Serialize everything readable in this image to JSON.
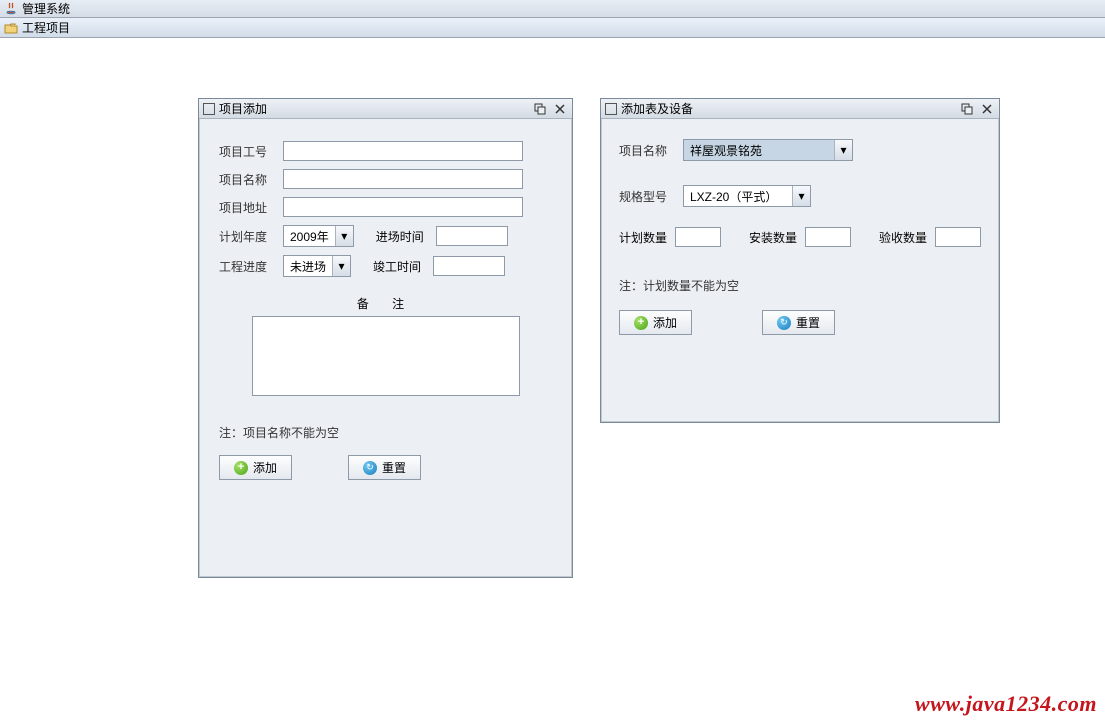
{
  "app": {
    "title": "管理系统",
    "menu_item": "工程项目"
  },
  "win1": {
    "title": "项目添加",
    "labels": {
      "project_no": "项目工号",
      "project_name": "项目名称",
      "project_addr": "项目地址",
      "plan_year": "计划年度",
      "enter_time": "进场时间",
      "progress": "工程进度",
      "finish_time": "竣工时间",
      "remark": "备   注"
    },
    "values": {
      "project_no": "",
      "project_name": "",
      "project_addr": "",
      "plan_year": "2009年",
      "enter_time": "",
      "progress": "未进场",
      "finish_time": "",
      "remark": ""
    },
    "note": "注：项目名称不能为空",
    "btn_add": "添加",
    "btn_reset": "重置"
  },
  "win2": {
    "title": "添加表及设备",
    "labels": {
      "project_name": "项目名称",
      "spec_model": "规格型号",
      "plan_qty": "计划数量",
      "install_qty": "安装数量",
      "accept_qty": "验收数量"
    },
    "values": {
      "project_name": "祥屋观景铭苑",
      "spec_model": "LXZ-20（平式）",
      "plan_qty": "",
      "install_qty": "",
      "accept_qty": ""
    },
    "note": "注：计划数量不能为空",
    "btn_add": "添加",
    "btn_reset": "重置"
  },
  "watermark": "www.java1234.com"
}
